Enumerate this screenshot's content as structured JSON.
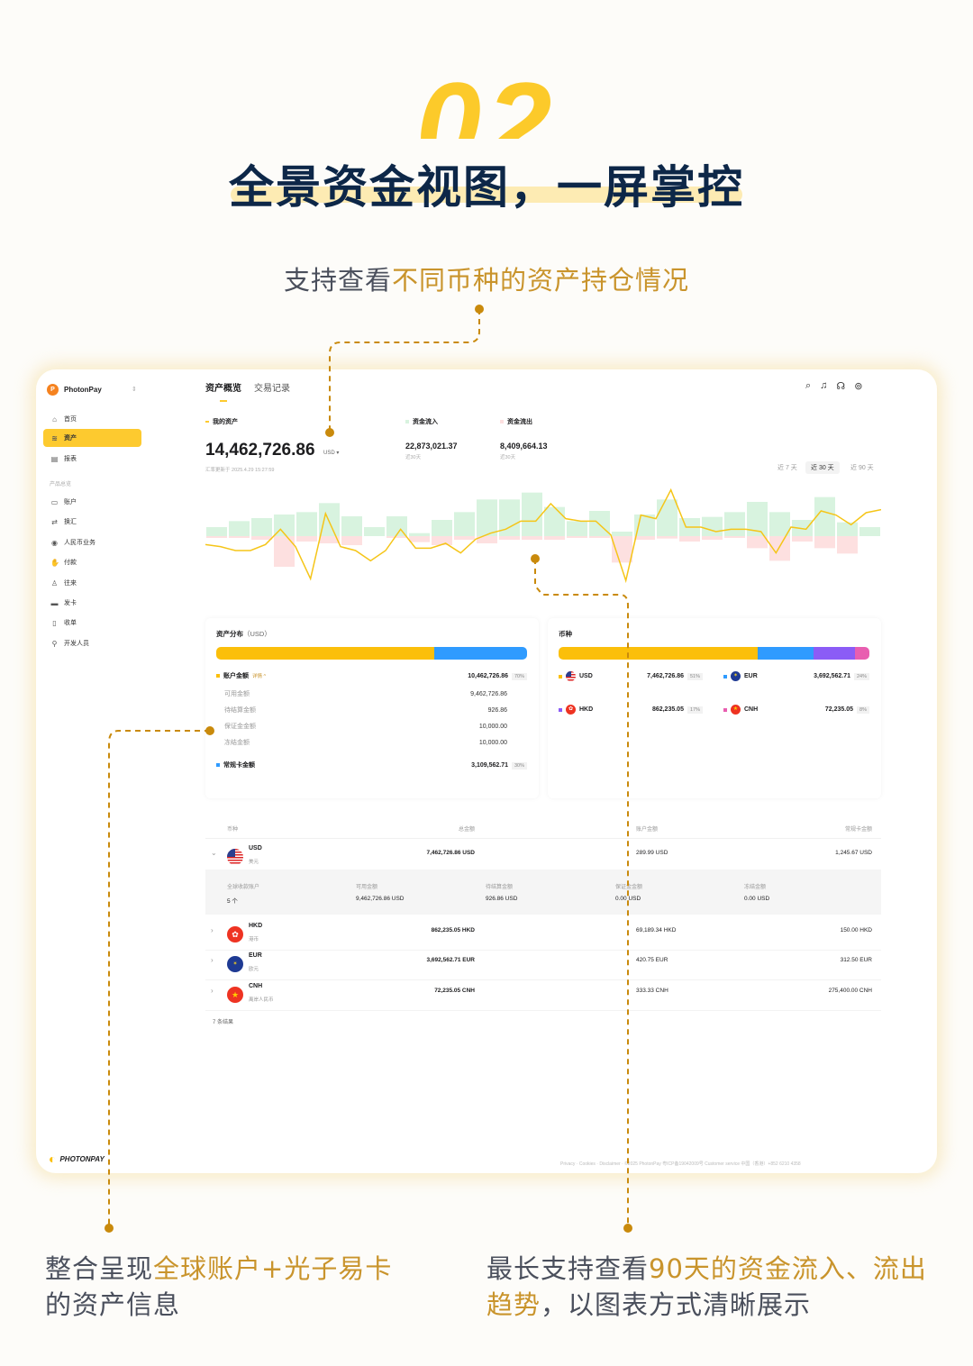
{
  "hero": {
    "number": "02",
    "title": "全景资金视图，一屏掌控",
    "subtitle_plain": "支持查看",
    "subtitle_highlight": "不同币种的资产持仓情况"
  },
  "callouts": {
    "left_plain": "整合呈现",
    "left_highlight": "全球账户+光子易卡",
    "left_plain2": "的资产信息",
    "right_plain": "最长支持查看",
    "right_highlight": "90天的资金流入、流出趋势",
    "right_plain2": "，以图表方式清晰展示"
  },
  "colors": {
    "accent": "#fdca2f",
    "gold": "#c9942c",
    "navy": "#0d2748",
    "inflow": "#d8f3df",
    "outflow": "#fde0e0",
    "line": "#f5c518",
    "usd": "#fbbf0a",
    "eur": "#2f9bff",
    "hkd": "#8b5cf6",
    "cnh": "#e85eb0"
  },
  "app": {
    "brand": "PhotonPay",
    "brand_letter": "P",
    "footer_logo": "PHOTONPAY",
    "sidebar": {
      "top": [
        {
          "icon": "home-icon",
          "label": "首页"
        },
        {
          "icon": "coins-icon",
          "label": "资产",
          "active": true
        },
        {
          "icon": "report-icon",
          "label": "报表"
        }
      ],
      "section": "产品总览",
      "items": [
        {
          "icon": "wallet-icon",
          "label": "账户"
        },
        {
          "icon": "exchange-icon",
          "label": "换汇"
        },
        {
          "icon": "rmb-icon",
          "label": "人民币业务"
        },
        {
          "icon": "payment-icon",
          "label": "付款"
        },
        {
          "icon": "contacts-icon",
          "label": "往来"
        },
        {
          "icon": "card-icon",
          "label": "发卡"
        },
        {
          "icon": "receipt-icon",
          "label": "收单"
        },
        {
          "icon": "developer-icon",
          "label": "开发人员"
        }
      ]
    },
    "tabs": [
      "资产概览",
      "交易记录"
    ],
    "toolbar_icons": [
      "search-icon",
      "bell-icon",
      "headset-icon",
      "settings-icon"
    ],
    "my_assets": {
      "label": "我的资产",
      "value": "14,462,726.86",
      "currency": "USD ▾",
      "updated": "汇率更新于 2025.4.29  15:27:59"
    },
    "inflow": {
      "label": "资金流入",
      "value": "22,873,021.37",
      "period": "近30天"
    },
    "outflow": {
      "label": "资金流出",
      "value": "8,409,664.13",
      "period": "近30天"
    },
    "ranges": [
      "近 7 天",
      "近 30 天",
      "近 90 天"
    ],
    "range_selected": "近 30 天",
    "distribution": {
      "title": "资产分布",
      "unit": "（USD）",
      "account_share": 70,
      "account": {
        "label": "账户金额",
        "detail": "详情 ^",
        "value": "10,462,726.86",
        "pct": "70%"
      },
      "sub": [
        {
          "label": "可用金额",
          "value": "9,462,726.86"
        },
        {
          "label": "待结算金额",
          "value": "926.86"
        },
        {
          "label": "保证金金额",
          "value": "10,000.00"
        },
        {
          "label": "冻结金额",
          "value": "10,000.00"
        }
      ],
      "card": {
        "label": "常规卡金额",
        "value": "3,109,562.71",
        "pct": "30%"
      }
    },
    "currencies": {
      "title": "币种",
      "shares": [
        {
          "code": "USD",
          "share": 64
        },
        {
          "code": "EUR",
          "share": 18
        },
        {
          "code": "HKD",
          "share": 13.5
        },
        {
          "code": "CNH",
          "share": 4.5
        }
      ],
      "items": [
        {
          "code": "USD",
          "value": "7,462,726.86",
          "pct": "51%"
        },
        {
          "code": "EUR",
          "value": "3,692,562.71",
          "pct": "24%"
        },
        {
          "code": "HKD",
          "value": "862,235.05",
          "pct": "17%"
        },
        {
          "code": "CNH",
          "value": "72,235.05",
          "pct": "8%"
        }
      ]
    },
    "table": {
      "headers": [
        "币种",
        "总金额",
        "账户金额",
        "常规卡金额"
      ],
      "rows": [
        {
          "code": "USD",
          "name": "美元",
          "total": "7,462,726.86 USD",
          "account": "289.99 USD",
          "card": "1,245.67 USD",
          "expanded": true
        },
        {
          "code": "HKD",
          "name": "港币",
          "total": "862,235.05 HKD",
          "account": "69,189.34 HKD",
          "card": "150.00 HKD"
        },
        {
          "code": "EUR",
          "name": "欧元",
          "total": "3,692,562.71 EUR",
          "account": "420.75 EUR",
          "card": "312.50 EUR"
        },
        {
          "code": "CNH",
          "name": "离岸人民币",
          "total": "72,235.05 CNH",
          "account": "333.33 CNH",
          "card": "275,400.00 CNH"
        }
      ],
      "expanded": {
        "headers": [
          "全球收款账户",
          "可用金额",
          "待结算金额",
          "保证金金额",
          "冻结金额"
        ],
        "values": [
          "5 个",
          "9,462,726.86 USD",
          "926.86 USD",
          "0.00 USD",
          "0.00 USD"
        ]
      },
      "count": "7 条结果"
    },
    "footer": "Privacy · Cookies · Disclaimer · ©2025 PhotonPay 粤ICP备19042009号    Customer service 中国（香港）+852 6210 4358"
  },
  "chart_data": {
    "type": "bar",
    "series": [
      {
        "kind": "bar-positive",
        "values": [
          30,
          50,
          60,
          72,
          80,
          110,
          66,
          30,
          66,
          10,
          54,
          80,
          122,
          122,
          145,
          97,
          50,
          84,
          15,
          72,
          122,
          60,
          64,
          80,
          114,
          80,
          54,
          130,
          46,
          30
        ]
      },
      {
        "kind": "bar-negative",
        "values": [
          6,
          6,
          12,
          102,
          18,
          24,
          30,
          0,
          6,
          20,
          30,
          12,
          24,
          12,
          12,
          12,
          6,
          6,
          88,
          12,
          8,
          18,
          12,
          6,
          40,
          82,
          18,
          40,
          58,
          0
        ]
      },
      {
        "kind": "line",
        "values": [
          -28,
          -35,
          -48,
          -48,
          -28,
          23,
          -35,
          -142,
          75,
          -35,
          -48,
          -82,
          -48,
          23,
          -40,
          -40,
          -24,
          -56,
          -10,
          10,
          23,
          50,
          50,
          108,
          58,
          50,
          50,
          4,
          -148,
          70,
          58,
          154,
          30,
          30,
          15,
          23,
          23,
          15,
          -56,
          30,
          23,
          84,
          70,
          38,
          78,
          88
        ]
      }
    ],
    "grid": false,
    "axes": false
  }
}
